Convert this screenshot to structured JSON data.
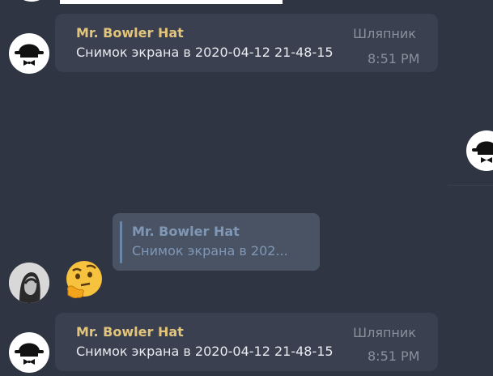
{
  "colors": {
    "background": "#2f3542",
    "bubble": "#3a4050",
    "author": "#e2c57a",
    "muted": "#8a909a",
    "text": "#e8eaee",
    "reply_card": "#4a5364",
    "reply_text": "#7f97b5"
  },
  "messages": [
    {
      "author": "Mr. Bowler Hat",
      "rank": "Шляпник",
      "text": "Снимок экрана в 2020-04-12 21-48-15",
      "time": "8:51 PM",
      "avatar_icon": "bowler-hat-icon"
    },
    {
      "author": "Mr. Bowler Hat",
      "rank": "Шляпник",
      "text": "Снимок экрана в 2020-04-12 21-48-15",
      "time": "8:51 PM",
      "avatar_icon": "bowler-hat-icon"
    }
  ],
  "reply": {
    "author": "Mr. Bowler Hat",
    "text": "Снимок экрана в 202..."
  },
  "emoji_message": {
    "emoji_icon": "thinking-face-icon",
    "avatar_icon": "user-photo-icon"
  }
}
